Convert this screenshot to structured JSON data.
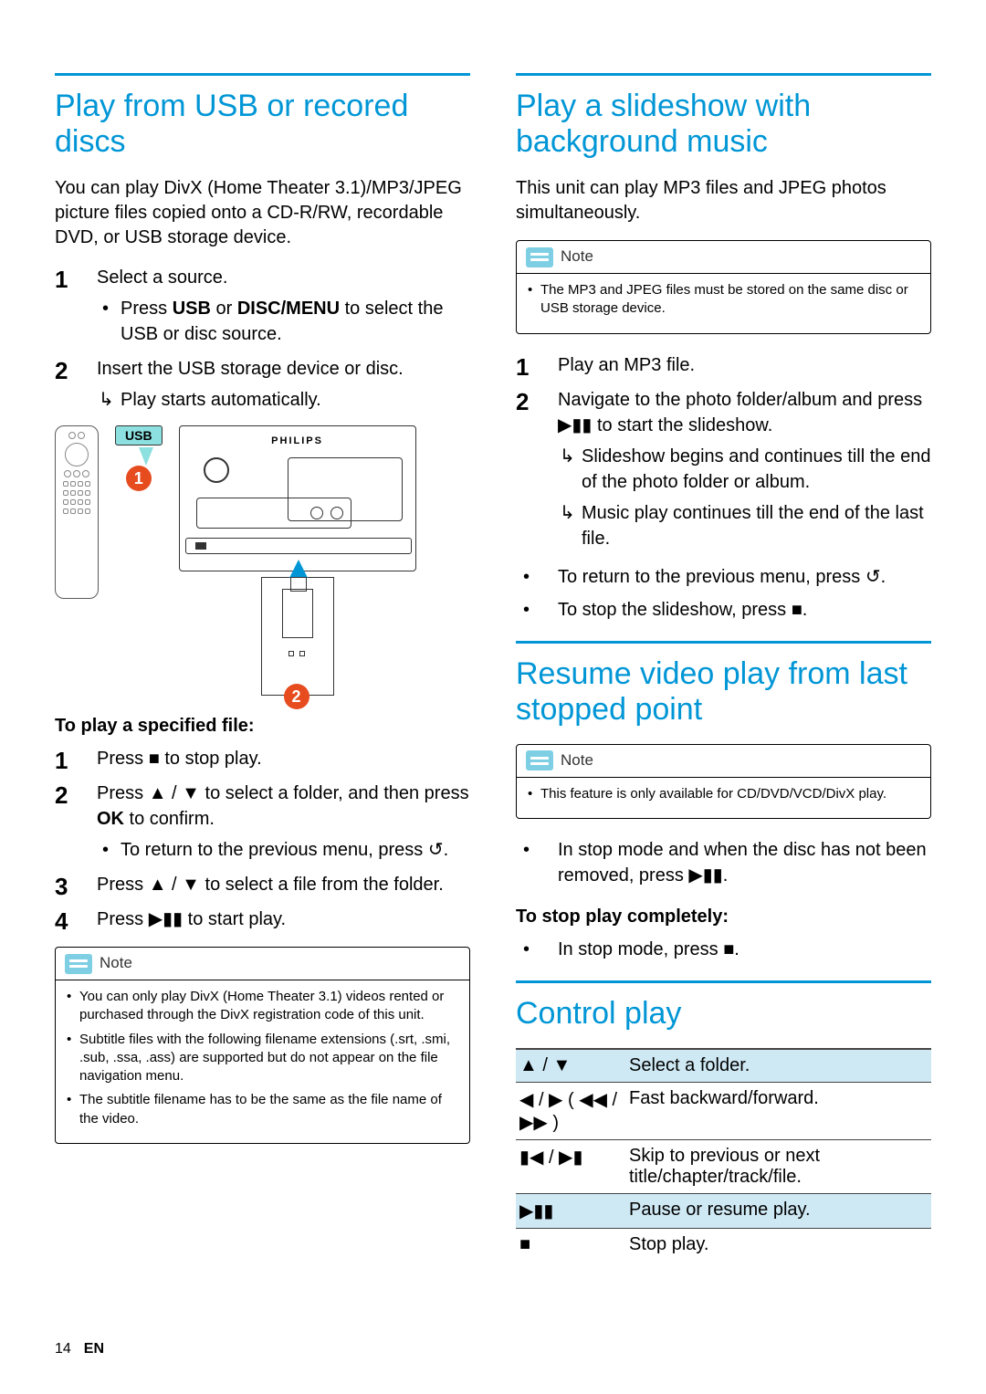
{
  "page": {
    "number": "14",
    "lang": "EN"
  },
  "left": {
    "title": "Play from USB or recored discs",
    "intro": "You can play DivX (Home Theater 3.1)/MP3/JPEG picture files copied onto a CD-R/RW, recordable DVD, or USB storage device.",
    "step1": "Select a source.",
    "step1_sub_prefix": "Press ",
    "step1_usb": "USB",
    "step1_or": " or ",
    "step1_discmenu": "DISC/MENU",
    "step1_sub_suffix": " to select the USB or disc source.",
    "step2": "Insert the USB storage device or disc.",
    "step2_sub": "Play starts automatically.",
    "illus": {
      "usb_label": "USB",
      "brand": "PHILIPS",
      "num1": "1",
      "num2": "2"
    },
    "spec_head": "To play a specified file:",
    "s1a": "Press ",
    "s1b": " to stop play.",
    "s2a": "Press ",
    "s2b": " to select a folder, and then press ",
    "s2ok": "OK",
    "s2c": " to confirm.",
    "s2_sub": "To return to the previous menu, press ",
    "s3a": "Press ",
    "s3b": " to select a file from the folder.",
    "s4a": "Press ",
    "s4b": " to start play.",
    "note_label": "Note",
    "notes": [
      "You can only play DivX (Home Theater 3.1) videos rented or purchased through the DivX registration code of this unit.",
      "Subtitle files with the following filename extensions (.srt, .smi, .sub, .ssa, .ass) are supported but do not appear on the file navigation menu.",
      "The subtitle filename has to be the same as the file name of the video."
    ]
  },
  "right": {
    "slide_title": "Play a slideshow with background music",
    "slide_intro": "This unit can play MP3 files and JPEG photos simultaneously.",
    "slide_note_label": "Note",
    "slide_note": "The MP3 and JPEG files must be stored on the same disc or USB storage device.",
    "slide_s1": "Play an MP3 file.",
    "slide_s2a": "Navigate to the photo folder/album and press ",
    "slide_s2b": " to start the slideshow.",
    "slide_sub1": "Slideshow begins and continues till the end of the photo folder or album.",
    "slide_sub2": "Music play continues till the end of the last file.",
    "slide_b1a": "To return to the previous menu, press ",
    "slide_b1b": ".",
    "slide_b2a": "To stop the slideshow, press ",
    "slide_b2b": ".",
    "resume_title": "Resume video play from last stopped point",
    "resume_note_label": "Note",
    "resume_note": "This feature is only available for CD/DVD/VCD/DivX play.",
    "resume_b1a": "In stop mode and when the disc has not been removed, press ",
    "resume_b1b": ".",
    "resume_head": "To stop play completely:",
    "resume_b2a": "In stop mode, press ",
    "resume_b2b": ".",
    "control_title": "Control play",
    "controls": [
      {
        "key": "▲ / ▼",
        "desc": "Select a folder."
      },
      {
        "key": "◀ / ▶ ( ◀◀ / ▶▶ )",
        "desc": "Fast backward/forward."
      },
      {
        "key": "▮◀ / ▶▮",
        "desc": "Skip to previous or next title/chapter/track/file."
      },
      {
        "key": "▶▮▮",
        "desc": "Pause or resume play."
      },
      {
        "key": "■",
        "desc": "Stop play."
      }
    ]
  },
  "sym": {
    "stop": "■",
    "updown": "▲ / ▼",
    "back": "↺",
    "playpause": "▶▮▮"
  }
}
